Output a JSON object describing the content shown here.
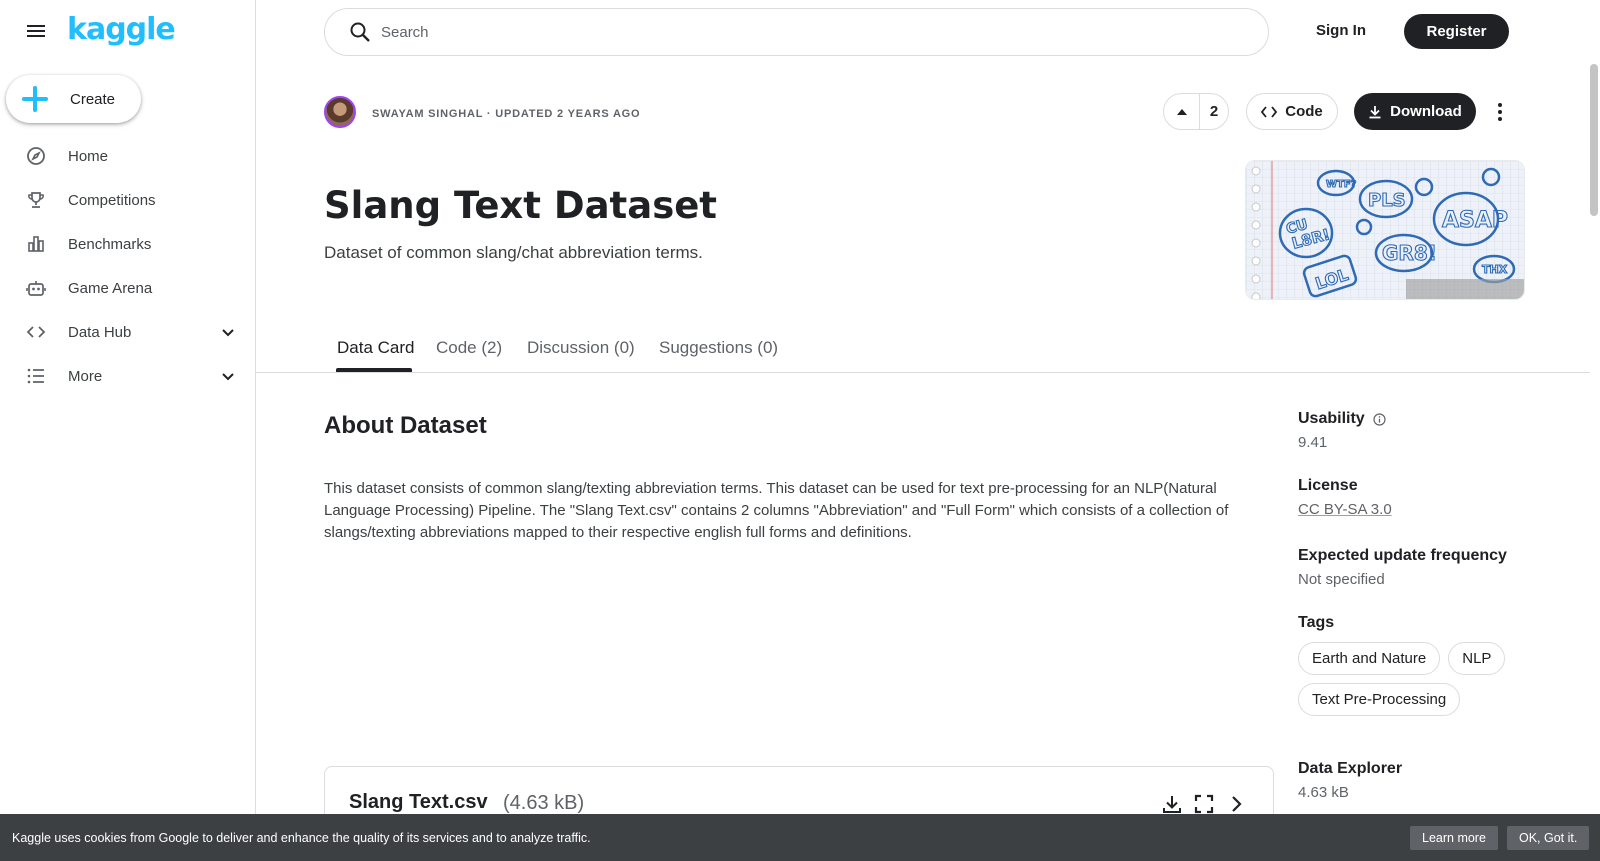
{
  "sidebar": {
    "logo": "kaggle",
    "create_label": "Create",
    "items": [
      {
        "label": "Home",
        "icon": "compass-icon"
      },
      {
        "label": "Competitions",
        "icon": "trophy-icon"
      },
      {
        "label": "Benchmarks",
        "icon": "bar-chart-icon"
      },
      {
        "label": "Game Arena",
        "icon": "robot-icon"
      },
      {
        "label": "Data Hub",
        "icon": "code-icon"
      },
      {
        "label": "More",
        "icon": "list-icon"
      }
    ]
  },
  "topbar": {
    "search_placeholder": "Search",
    "signin_label": "Sign In",
    "register_label": "Register"
  },
  "header": {
    "byline": "SWAYAM SINGHAL · UPDATED 2 YEARS AGO",
    "vote_count": "2",
    "code_label": "Code",
    "download_label": "Download",
    "title": "Slang Text Dataset",
    "subtitle": "Dataset of common slang/chat abbreviation terms.",
    "cover_words": [
      "CU L8R!",
      "WTF?",
      "PLS",
      "ASAP",
      "GR8!",
      "LOL",
      "THX"
    ]
  },
  "tabs": [
    {
      "label": "Data Card",
      "active": true
    },
    {
      "label": "Code (2)",
      "active": false
    },
    {
      "label": "Discussion (0)",
      "active": false
    },
    {
      "label": "Suggestions (0)",
      "active": false
    }
  ],
  "about": {
    "title": "About Dataset",
    "text": "This dataset consists of common slang/texting abbreviation terms. This dataset can be used for text pre-processing for an NLP(Natural Language Processing) Pipeline. The \"Slang Text.csv\" contains 2 columns \"Abbreviation\" and \"Full Form\" which consists of a collection of slangs/texting abbreviations mapped to their respective english full forms and definitions."
  },
  "side": {
    "usability_label": "Usability",
    "usability_value": "9.41",
    "license_label": "License",
    "license_value": "CC BY-SA 3.0",
    "frequency_label": "Expected update frequency",
    "frequency_value": "Not specified",
    "tags_label": "Tags",
    "tags": [
      "Earth and Nature",
      "NLP",
      "Text Pre-Processing"
    ],
    "explorer_label": "Data Explorer",
    "explorer_value": "4.63 kB"
  },
  "file": {
    "name": "Slang Text.csv",
    "size": "(4.63 kB)"
  },
  "cookie": {
    "text": "Kaggle uses cookies from Google to deliver and enhance the quality of its services and to analyze traffic.",
    "learn_more": "Learn more",
    "ok": "OK, Got it."
  },
  "colors": {
    "brand": "#20beff",
    "primary_button": "#202124",
    "avatar_ring": "#a142f4",
    "cookie_bg": "#3c4043"
  }
}
